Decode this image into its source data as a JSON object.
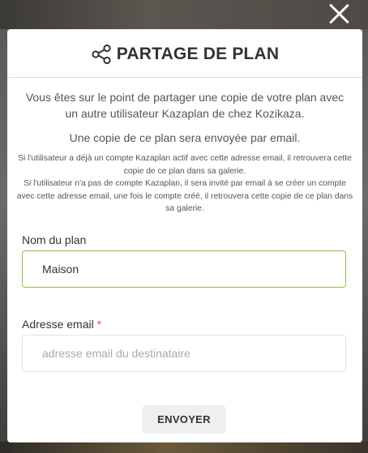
{
  "modal": {
    "title": "PARTAGE DE PLAN",
    "intro": "Vous êtes sur le point de partager une copie de votre plan avec un autre utilisateur Kazaplan de chez Kozikaza.",
    "intro2": "Une copie de ce plan sera envoyée par email.",
    "note_line1": "Si l'utilisateur a déjà un compte Kazaplan actif avec cette adresse email, il retrouvera cette copie de ce plan dans sa galerie.",
    "note_line2": "Si l'utilisateur n'a pas de compte Kazaplan, il sera invité par email à se créer un compte avec cette adresse email, une fois le compte créé, il retrouvera cette copie de ce plan dans sa galerie."
  },
  "form": {
    "plan_name_label": "Nom du plan",
    "plan_name_value": "Maison",
    "email_label": "Adresse email",
    "email_required_marker": "*",
    "email_placeholder": "adresse email du destinataire",
    "submit_label": "ENVOYER"
  },
  "icons": {
    "header": "share-icon",
    "close": "close-icon"
  },
  "colors": {
    "accent_border": "#8cc24a",
    "required": "#d9534f",
    "button_bg": "#efefef"
  }
}
